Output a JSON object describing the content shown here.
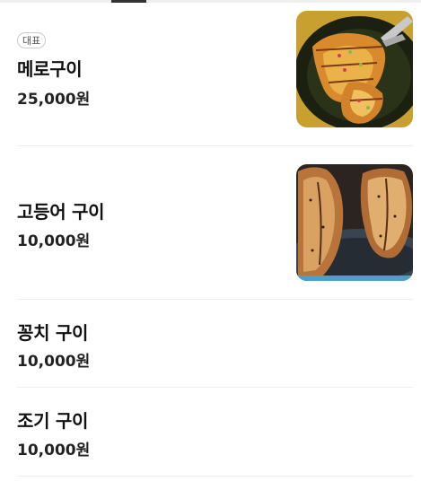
{
  "menu": {
    "items": [
      {
        "badge": "대표",
        "name": "메로구이",
        "price": "25,000원",
        "image": "grilled-fish-photo"
      },
      {
        "name": "고등어 구이",
        "price": "10,000원",
        "image": "grilled-mackerel-photo"
      },
      {
        "name": "꽁치 구이",
        "price": "10,000원"
      },
      {
        "name": "조기 구이",
        "price": "10,000원"
      }
    ]
  }
}
